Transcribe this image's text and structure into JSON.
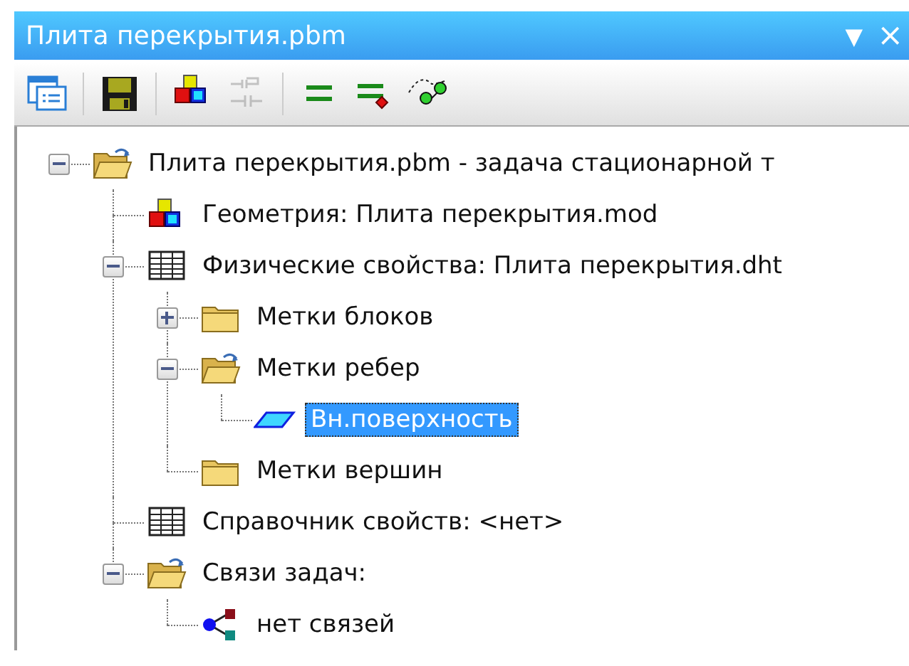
{
  "window": {
    "title": "Плита перекрытия.pbm",
    "menu_glyph": "▼",
    "close_glyph": "×"
  },
  "toolbar": [
    {
      "kind": "window",
      "disabled": false
    },
    {
      "kind": "separator"
    },
    {
      "kind": "save",
      "disabled": false
    },
    {
      "kind": "separator"
    },
    {
      "kind": "cubes",
      "disabled": false
    },
    {
      "kind": "connector",
      "disabled": true
    },
    {
      "kind": "separator"
    },
    {
      "kind": "equals",
      "disabled": false
    },
    {
      "kind": "equals-dot",
      "disabled": false
    },
    {
      "kind": "nodes",
      "disabled": false
    }
  ],
  "tree": [
    {
      "label": "Плита перекрытия.pbm - задача стационарной т",
      "kind": "open-folder",
      "expanded": true,
      "selected": false,
      "children": [
        {
          "label": "Геометрия: Плита перекрытия.mod",
          "kind": "cubes",
          "selected": false
        },
        {
          "label": "Физические свойства: Плита перекрытия.dht",
          "kind": "table",
          "expanded": true,
          "selected": false,
          "children": [
            {
              "label": "Метки блоков",
              "kind": "folder",
              "expanded": false,
              "selected": false
            },
            {
              "label": "Метки ребер",
              "kind": "open-folder",
              "expanded": true,
              "selected": false,
              "children": [
                {
                  "label": "Вн.поверхность",
                  "kind": "surface",
                  "selected": true
                }
              ]
            },
            {
              "label": "Метки вершин",
              "kind": "folder",
              "selected": false
            }
          ]
        },
        {
          "label": "Справочник свойств: <нет>",
          "kind": "table",
          "selected": false
        },
        {
          "label": "Связи задач:",
          "kind": "open-folder",
          "expanded": true,
          "selected": false,
          "children": [
            {
              "label": "нет связей",
              "kind": "links",
              "selected": false
            }
          ]
        }
      ]
    }
  ]
}
